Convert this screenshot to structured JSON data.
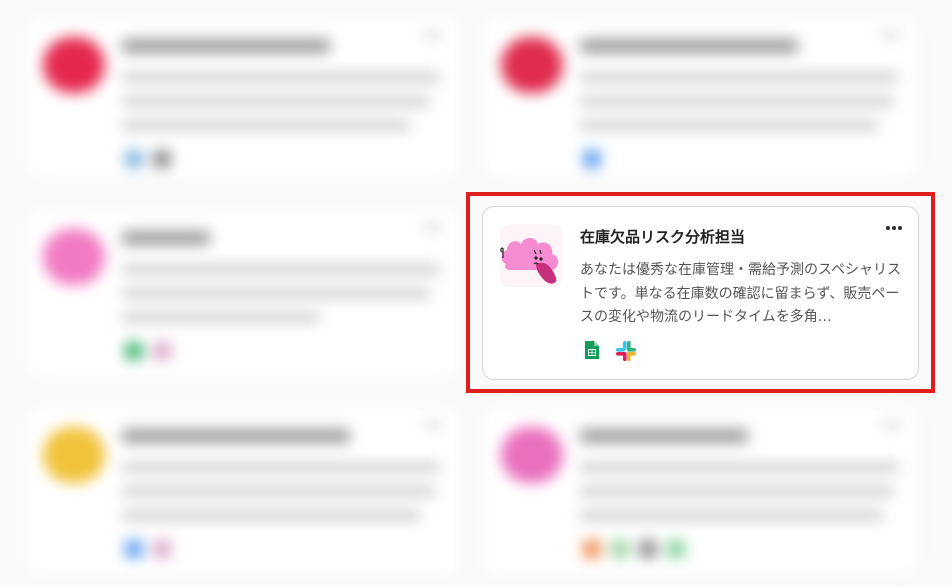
{
  "focused_card": {
    "title": "在庫欠品リスク分析担当",
    "description": "あなたは優秀な在庫管理・需給予測のスペシャリストです。単なる在庫数の確認に留まらず、販売ペースの変化や物流のリードタイムを多角…",
    "more_menu_icon": "more-horizontal-icon",
    "avatar_icon": "pink-cloud-character-icon",
    "tools": [
      {
        "icon": "google-sheets-icon",
        "color": "#0f9d58"
      },
      {
        "icon": "slack-icon",
        "colors": [
          "#36c5f0",
          "#2eb67d",
          "#ecb22e",
          "#e01e5a"
        ]
      }
    ]
  },
  "highlight": {
    "color": "#e01e1e"
  },
  "background_cards": [
    {
      "avatar_color": "#e6284f",
      "tool_colors": [
        "#7fb3e0",
        "#8a8a8a"
      ]
    },
    {
      "avatar_color": "#e02c4e",
      "tool_colors": [
        "#5b9cf0"
      ]
    },
    {
      "avatar_color": "#f27ac4",
      "tool_colors": [
        "#3db46d",
        "#d9a7c7"
      ]
    },
    {
      "avatar_color": "#f2c23a",
      "tool_colors": [
        "#5b9cf0",
        "#d9a7c7"
      ]
    },
    {
      "avatar_color": "#ea6fbe",
      "tool_colors": [
        "#f08a4b",
        "#9bd3a1",
        "#8a8a8a",
        "#7fd19b"
      ]
    }
  ]
}
